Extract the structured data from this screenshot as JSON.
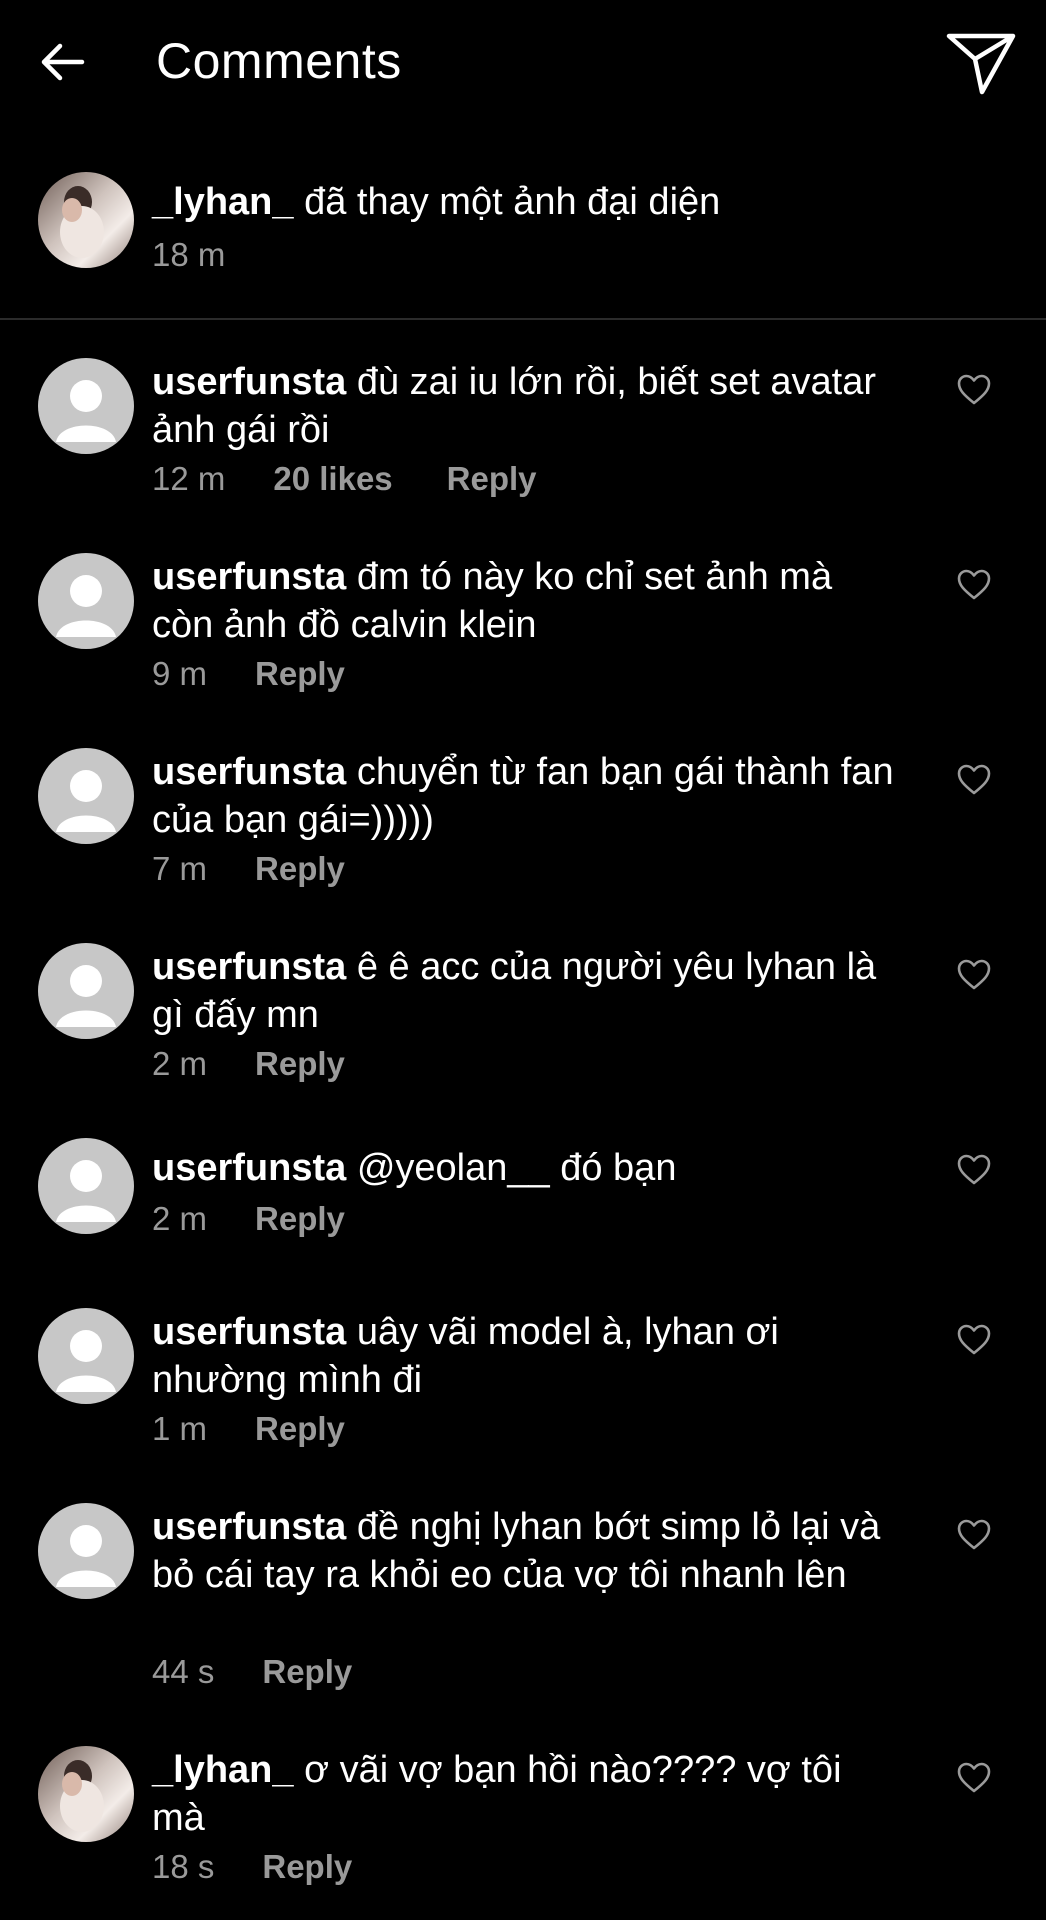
{
  "header": {
    "title": "Comments",
    "back_icon": "arrow-left-icon",
    "send_icon": "send-icon"
  },
  "caption": {
    "username": "_lyhan_",
    "text": "đã thay một ảnh đại diện",
    "time": "18 m"
  },
  "comments": [
    {
      "username": "userfunsta",
      "text": "đù zai iu lớn rồi, biết set avatar ảnh gái rồi",
      "time": "12 m",
      "likes": "20 likes",
      "reply": "Reply"
    },
    {
      "username": "userfunsta",
      "text": "đm tó này ko chỉ set ảnh mà còn ảnh đồ calvin klein",
      "time": "9 m",
      "reply": "Reply"
    },
    {
      "username": "userfunsta",
      "text": "chuyển từ fan bạn gái thành fan của bạn gái=)))))",
      "time": "7 m",
      "reply": "Reply"
    },
    {
      "username": "userfunsta",
      "text": "ê ê acc của người yêu lyhan là gì đấy mn",
      "time": "2 m",
      "reply": "Reply"
    },
    {
      "username": "userfunsta",
      "text": "@yeolan__ đó bạn",
      "time": "2 m",
      "reply": "Reply"
    },
    {
      "username": "userfunsta",
      "text": "uây vãi model à, lyhan ơi nhường mình đi",
      "time": "1 m",
      "reply": "Reply"
    },
    {
      "username": "userfunsta",
      "text": "đề nghị lyhan bớt simp lỏ lại và bỏ cái tay ra khỏi eo của vợ tôi nhanh lên",
      "time": "44 s",
      "reply": "Reply"
    },
    {
      "username": "_lyhan_",
      "text": "ơ vãi vợ bạn hồi nào???? vợ tôi mà",
      "time": "18 s",
      "reply": "Reply"
    }
  ],
  "colors": {
    "background": "#000000",
    "text": "#ffffff",
    "meta": "#9a9a9a",
    "avatar_default": "#c7c7c7"
  }
}
